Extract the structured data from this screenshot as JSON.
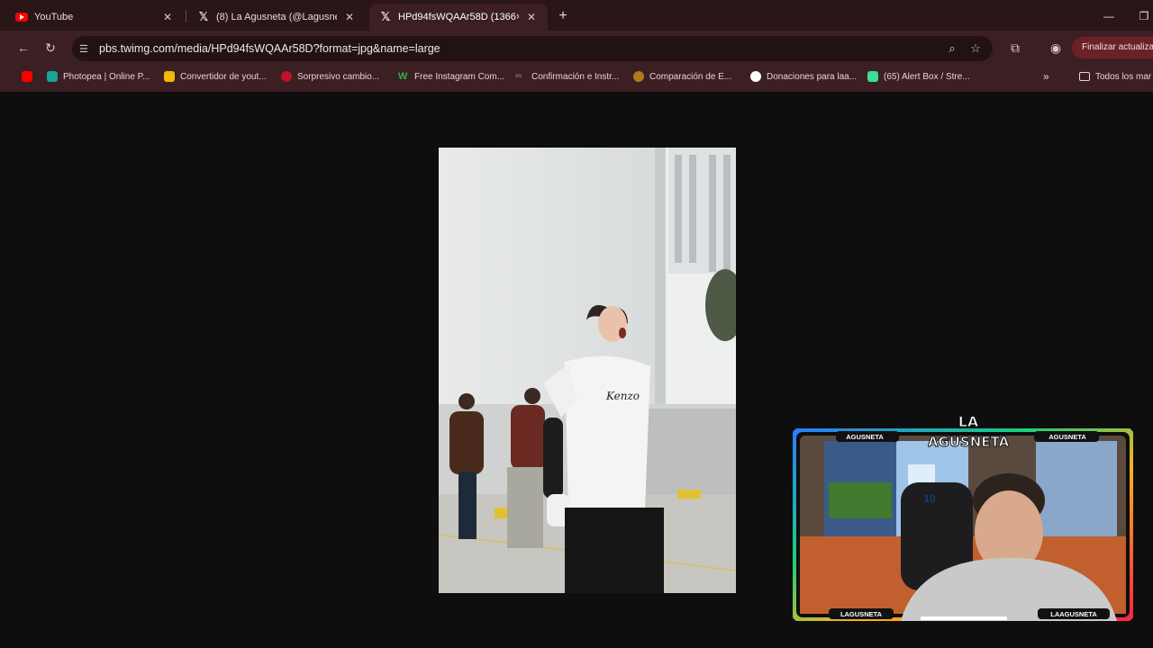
{
  "tabs": [
    {
      "title": "YouTube",
      "icon": "youtube-icon"
    },
    {
      "title": "(8) La Agusneta (@Lagusneta) /",
      "icon": "x-icon"
    },
    {
      "title": "HPd94fsWQAAr58D (1366×204",
      "icon": "x-icon",
      "active": true
    }
  ],
  "toolbar": {
    "url": "pbs.twimg.com/media/HPd94fsWQAAr58D?format=jpg&name=large",
    "update_label": "Finalizar actualiza"
  },
  "bookmarks": [
    {
      "label": "",
      "color": "#ff0000"
    },
    {
      "label": "Photopea | Online P...",
      "color": "#18a497"
    },
    {
      "label": "Convertidor de yout...",
      "color": "#f5b800"
    },
    {
      "label": "Sorpresivo cambio...",
      "color": "#c0102a"
    },
    {
      "label": "Free Instagram Com...",
      "color": "#2bb24c"
    },
    {
      "label": "Confirmación e Instr...",
      "color": "#8a8a8a"
    },
    {
      "label": "Comparación de E...",
      "color": "#b07a1a"
    },
    {
      "label": "Donaciones para laa...",
      "color": "#ffffff"
    },
    {
      "label": "(65) Alert Box / Stre...",
      "color": "#3ddc97"
    },
    {
      "label": "Todos los mar",
      "color": "#e4d6d6"
    }
  ],
  "overlay": {
    "logo_text": "LA AGUSNETA",
    "instagram": "AGUSNETA",
    "youtube": "AGUSNETA",
    "x": "LAGUSNETA",
    "tiktok": "LAAGUSNETA",
    "jersey_number": "10"
  },
  "photo_shirt_text": "Kenzo"
}
